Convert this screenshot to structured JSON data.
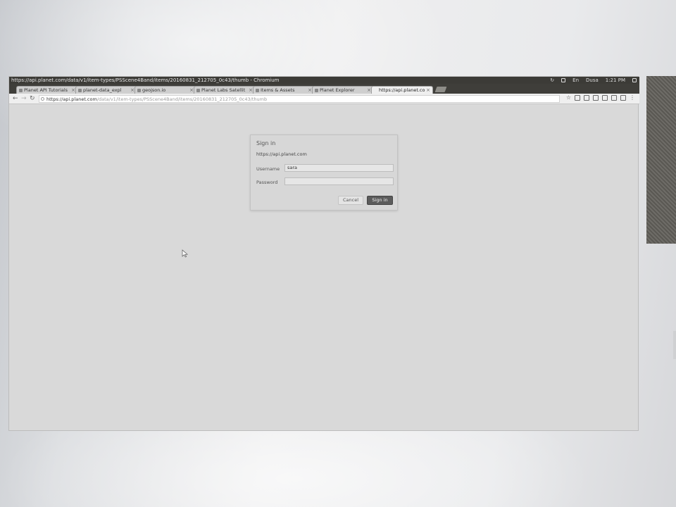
{
  "window": {
    "title": "https://api.planet.com/data/v1/item-types/PSScene4Band/items/20160831_212705_0c43/thumb - Chromium"
  },
  "tray": {
    "items": [
      "En",
      "Dusa",
      "1:21 PM"
    ]
  },
  "tabs": [
    {
      "label": "Planet API Tutorials",
      "active": false
    },
    {
      "label": "planet-data_expl",
      "active": false
    },
    {
      "label": "geojson.io",
      "active": false
    },
    {
      "label": "Planet Labs Satellit",
      "active": false
    },
    {
      "label": "Items & Assets",
      "active": false
    },
    {
      "label": "Planet Explorer",
      "active": false
    },
    {
      "label": "https://api.planet.co",
      "active": true
    }
  ],
  "toolbar": {
    "url_host": "https://api.planet.com",
    "url_path": "/data/v1/item-types/PSScene4Band/items/20160831_212705_0c43/thumb"
  },
  "dialog": {
    "title": "Sign in",
    "host": "https://api.planet.com",
    "username_label": "Username",
    "username_value": "sara",
    "password_label": "Password",
    "password_value": "",
    "cancel_label": "Cancel",
    "signin_label": "Sign in"
  },
  "colors": {
    "titlebar": "#3c3b37",
    "signin_button": "#5b5b5b"
  },
  "icons": [
    "reload-icon",
    "back-arrow-icon",
    "forward-arrow-icon",
    "star-icon",
    "menu-icon",
    "mouse-pointer-icon"
  ]
}
